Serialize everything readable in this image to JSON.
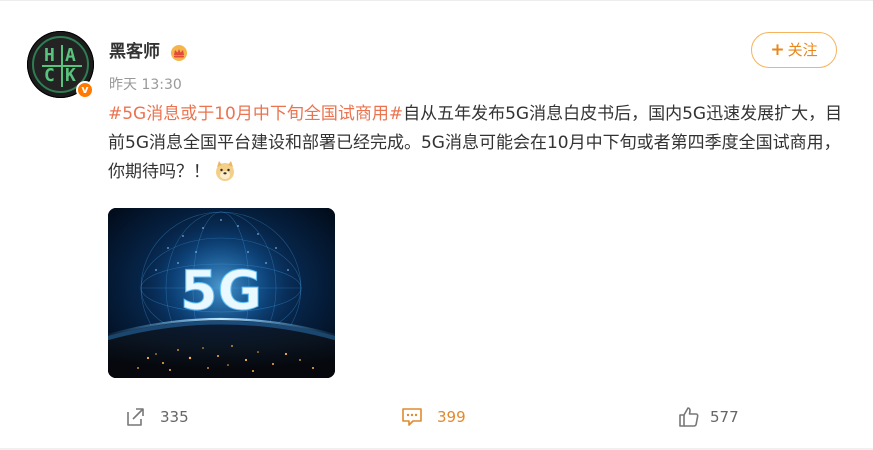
{
  "user": {
    "name": "黑客师",
    "avatar_text": [
      "H",
      "A",
      "C",
      "K"
    ],
    "verified_symbol": "v",
    "timestamp": "昨天 13:30"
  },
  "follow_button": {
    "label": "关注",
    "icon": "+"
  },
  "post": {
    "hashtag": "#5G消息或于10月中下旬全国试商用#",
    "text": "自从五年发布5G消息白皮书后，国内5G迅速发展扩大，目前5G消息全国平台建设和部署已经完成。5G消息可能会在10月中下旬或者第四季度全国试商用，你期待吗？！",
    "emoji": "doge-emoji"
  },
  "media": {
    "overlay_text": "5G"
  },
  "actions": {
    "share_count": "335",
    "comment_count": "399",
    "like_count": "577"
  },
  "colors": {
    "accent": "#eb7350",
    "follow_border": "#f7b35d",
    "comment_count": "#e08a2e",
    "avatar_green": "#58c37c",
    "verified": "#ff7a00"
  }
}
